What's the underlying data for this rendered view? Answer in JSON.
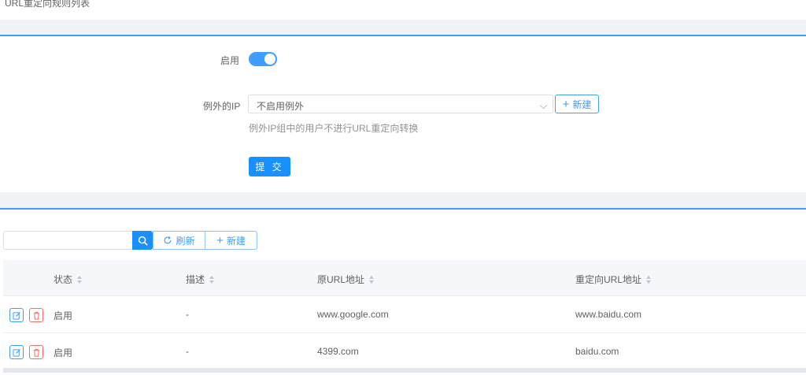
{
  "breadcrumb": "URL重定向规则列表",
  "form": {
    "enable_label": "启用",
    "enabled": true,
    "exception_label": "例外的IP",
    "exception_value": "不启用例外",
    "new_button": "新建",
    "hint": "例外IP组中的用户不进行URL重定向转换",
    "submit": "提 交"
  },
  "toolbar": {
    "search_placeholder": "",
    "refresh": "刷新",
    "new": "新建"
  },
  "table": {
    "columns": [
      "状态",
      "描述",
      "原URL地址",
      "重定向URL地址"
    ],
    "rows": [
      {
        "status": "启用",
        "desc": "-",
        "src": "www.google.com",
        "dst": "www.baidu.com"
      },
      {
        "status": "启用",
        "desc": "-",
        "src": "4399.com",
        "dst": "baidu.com"
      }
    ]
  },
  "colors": {
    "primary": "#1890ff",
    "danger": "#f56c6c"
  },
  "icons": [
    "search-icon",
    "refresh-icon",
    "plus-icon",
    "edit-icon",
    "delete-icon",
    "chevron-down-icon"
  ]
}
